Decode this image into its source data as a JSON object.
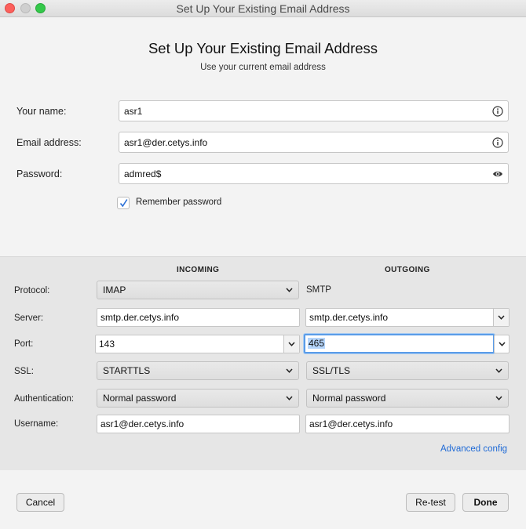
{
  "window": {
    "title": "Set Up Your Existing Email Address"
  },
  "header": {
    "title": "Set Up Your Existing Email Address",
    "subtitle": "Use your current email address"
  },
  "form": {
    "name_label": "Your name:",
    "name_value": "asr1",
    "email_label": "Email address:",
    "email_value": "asr1@der.cetys.info",
    "password_label": "Password:",
    "password_value": "admred$",
    "remember_label": "Remember password",
    "remember_checked": true,
    "name_icon": "info-icon",
    "email_icon": "info-icon",
    "password_icon": "eye-icon"
  },
  "server": {
    "incoming_header": "INCOMING",
    "outgoing_header": "OUTGOING",
    "protocol_label": "Protocol:",
    "protocol_in": "IMAP",
    "protocol_out": "SMTP",
    "server_label": "Server:",
    "server_in": "smtp.der.cetys.info",
    "server_out": "smtp.der.cetys.info",
    "port_label": "Port:",
    "port_in": "143",
    "port_out": "465",
    "ssl_label": "SSL:",
    "ssl_in": "STARTTLS",
    "ssl_out": "SSL/TLS",
    "auth_label": "Authentication:",
    "auth_in": "Normal password",
    "auth_out": "Normal password",
    "username_label": "Username:",
    "username_in": "asr1@der.cetys.info",
    "username_out": "asr1@der.cetys.info",
    "advanced_link": "Advanced config"
  },
  "actions": {
    "cancel": "Cancel",
    "retest": "Re-test",
    "done": "Done"
  },
  "colors": {
    "link": "#1f6ad6",
    "focus": "#5a9ce8",
    "close": "#fc605c",
    "maximize": "#34c84a"
  }
}
